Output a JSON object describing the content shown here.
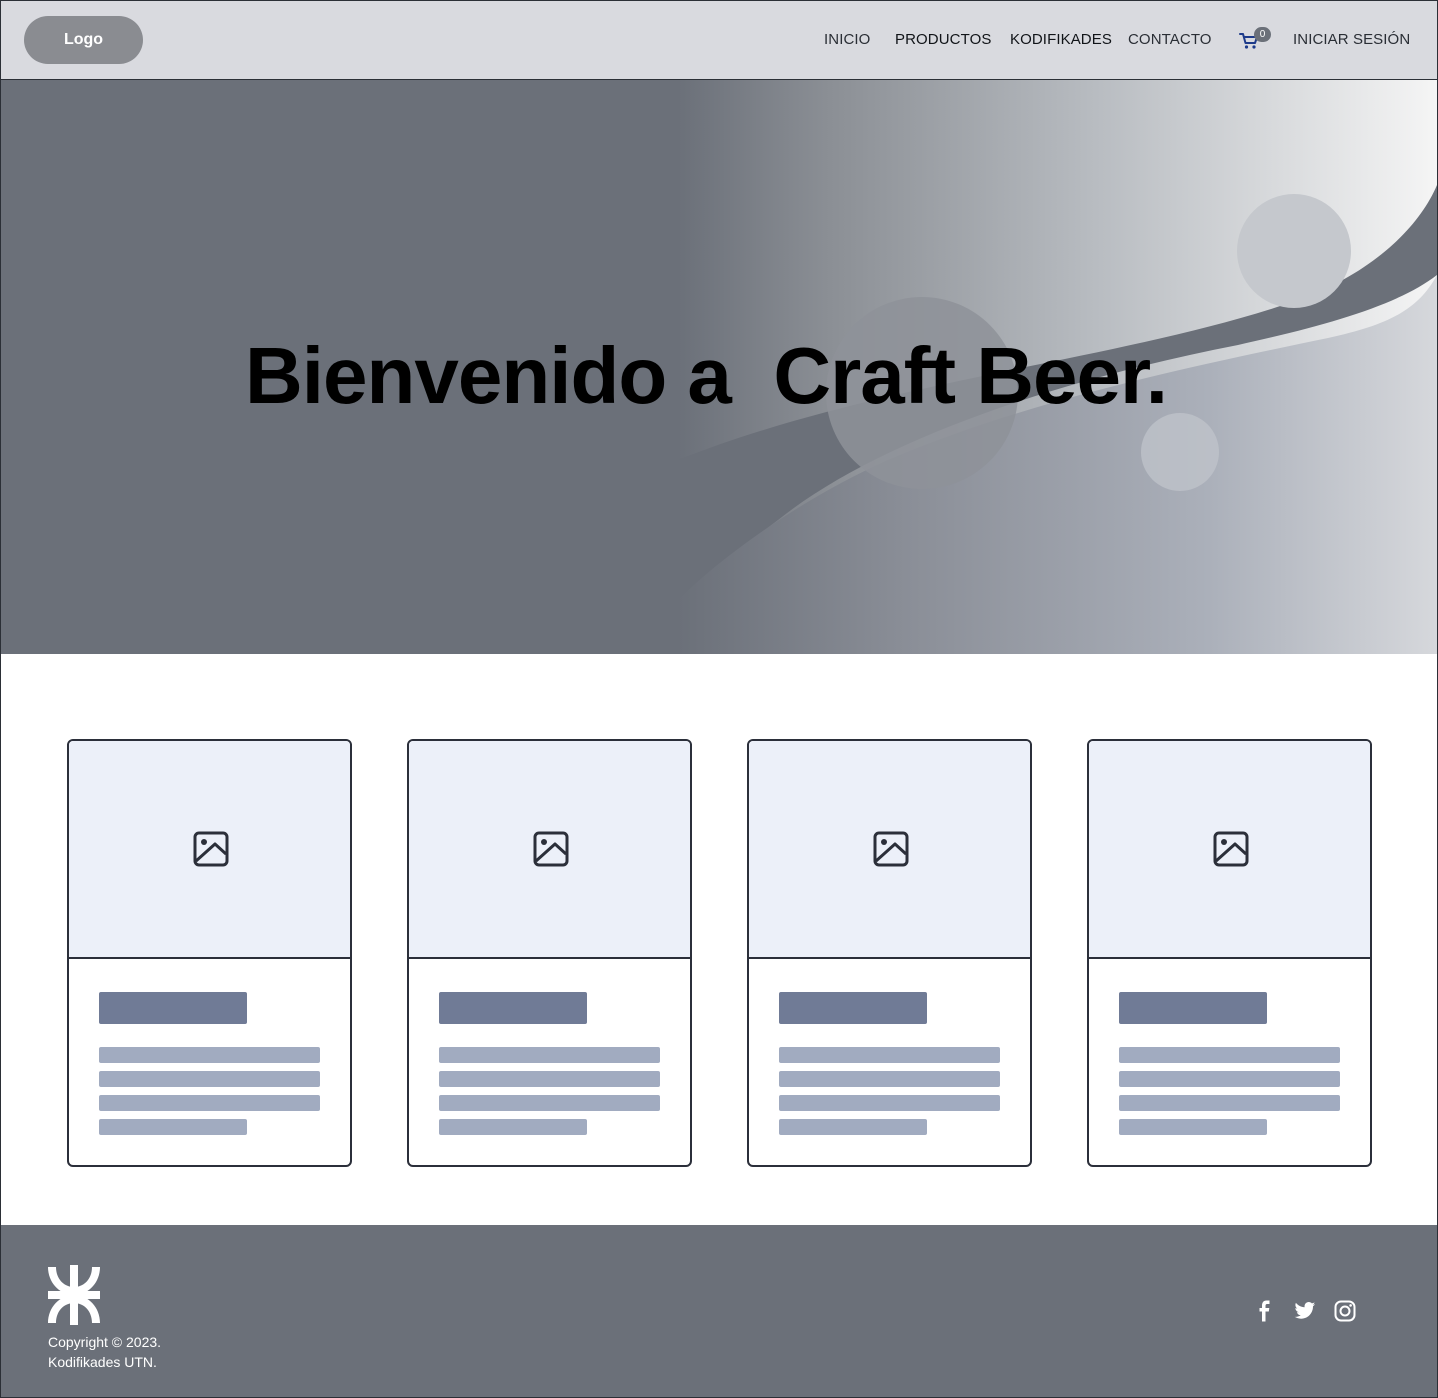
{
  "header": {
    "logo_label": "Logo",
    "nav": {
      "inicio": "INICIO",
      "productos": "PRODUCTOS",
      "kodifikades": "KODIFIKADES",
      "contacto": "CONTACTO",
      "login": "INICIAR SESIÓN"
    },
    "cart": {
      "icon": "shopping-cart-icon",
      "count": "0"
    }
  },
  "hero": {
    "title": "Bienvenido a  Craft Beer."
  },
  "cards": [
    {
      "image_icon": "image-placeholder-icon"
    },
    {
      "image_icon": "image-placeholder-icon"
    },
    {
      "image_icon": "image-placeholder-icon"
    },
    {
      "image_icon": "image-placeholder-icon"
    }
  ],
  "footer": {
    "logo_icon": "utn-logo-icon",
    "copyright_line1": "Copyright © 2023.",
    "copyright_line2": "Kodifikades UTN.",
    "social": [
      "facebook-icon",
      "twitter-icon",
      "instagram-icon"
    ]
  },
  "colors": {
    "header_bg": "#d9dadf",
    "hero_bg": "#6b7079",
    "footer_bg": "#6b7079",
    "card_image_bg": "#ecf0f9",
    "card_title_bar": "#707b96",
    "card_text_line": "#a1abc0",
    "cart_icon": "#1d3a8a"
  }
}
